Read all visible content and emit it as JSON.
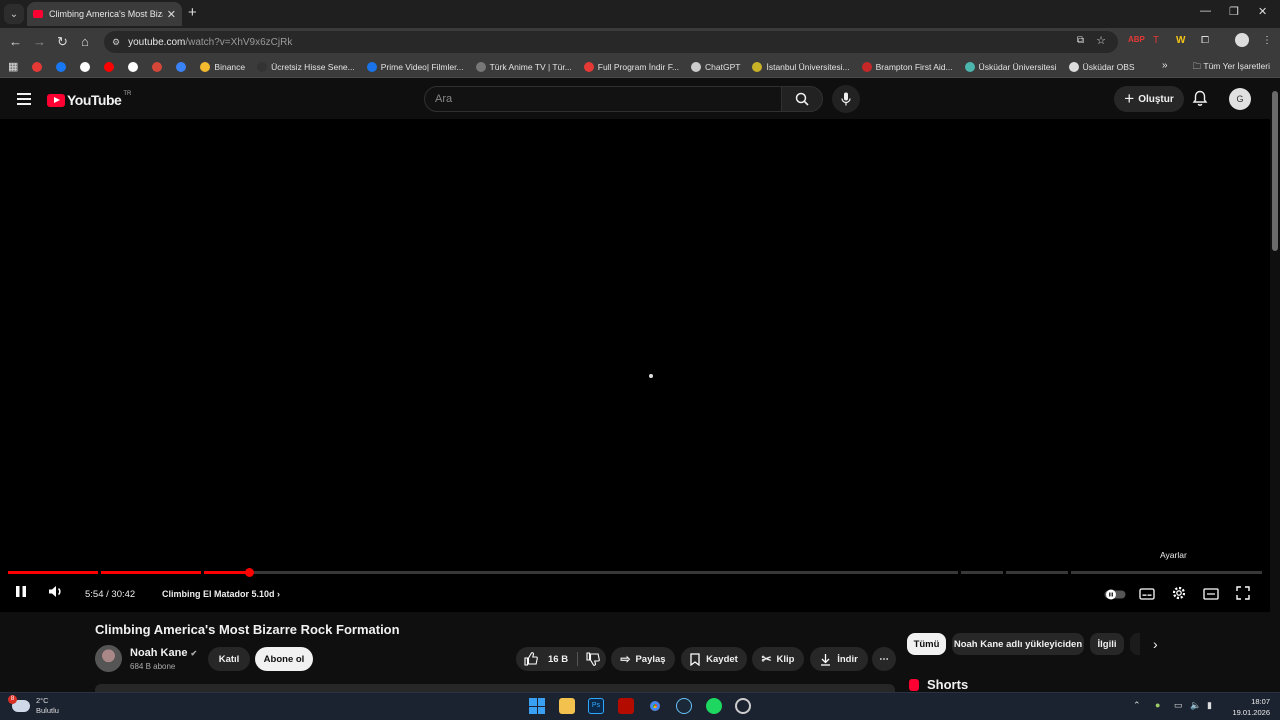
{
  "browser": {
    "tab_title": "Climbing America's Most Bizarre",
    "url_host": "youtube.com",
    "url_path": "/watch?v=XhV9x6zCjRk",
    "bookmarks": [
      {
        "label": "",
        "color": "#e53935"
      },
      {
        "label": "",
        "color": "#1877f2"
      },
      {
        "label": "",
        "color": "#ffffff"
      },
      {
        "label": "",
        "color": "#ff0000"
      },
      {
        "label": "",
        "color": "#ffffff"
      },
      {
        "label": "",
        "color": "#d44638"
      },
      {
        "label": "",
        "color": "#3b82f6"
      },
      {
        "label": "Binance",
        "color": "#f3ba2f"
      },
      {
        "label": "Ücretsiz Hisse Sene...",
        "color": "#333333"
      },
      {
        "label": "Prime Video| Filmler...",
        "color": "#1a73e8"
      },
      {
        "label": "Türk Anime TV | Tür...",
        "color": "#777777"
      },
      {
        "label": "Full Program İndir F...",
        "color": "#e53935"
      },
      {
        "label": "ChatGPT",
        "color": "#cccccc"
      },
      {
        "label": "İstanbul Üniversitesi...",
        "color": "#c9b227"
      },
      {
        "label": "Brampton First Aid...",
        "color": "#c62828"
      },
      {
        "label": "Üsküdar Üniversitesi",
        "color": "#4db6ac"
      },
      {
        "label": "Üsküdar OBS",
        "color": "#dddddd"
      }
    ],
    "all_bookmarks": "Tüm Yer İşaretleri"
  },
  "header": {
    "logo_text": "YouTube",
    "country": "TR",
    "search_placeholder": "Ara",
    "create_label": "Oluştur",
    "avatar_letter": "G"
  },
  "player": {
    "tooltip": "Ayarlar",
    "time": "5:54 / 30:42",
    "chapter": "Climbing El Matador 5.10d",
    "progress": 0.1922
  },
  "video": {
    "title": "Climbing America's Most Bizarre Rock Formation",
    "channel": "Noah Kane",
    "subscribers": "684 B abone",
    "join": "Katıl",
    "subscribe": "Abone ol",
    "likes": "16 B",
    "share": "Paylaş",
    "save": "Kaydet",
    "clip": "Klip",
    "download": "İndir"
  },
  "sidebar": {
    "chips": [
      "Tümü",
      "Noah Kane adlı yükleyiciden",
      "İlgili"
    ],
    "shorts": "Shorts"
  },
  "taskbar": {
    "temperature": "2°C",
    "condition": "Bulutlu",
    "weather_badge": "8",
    "time": "18:07",
    "date": "19.01.2026"
  }
}
